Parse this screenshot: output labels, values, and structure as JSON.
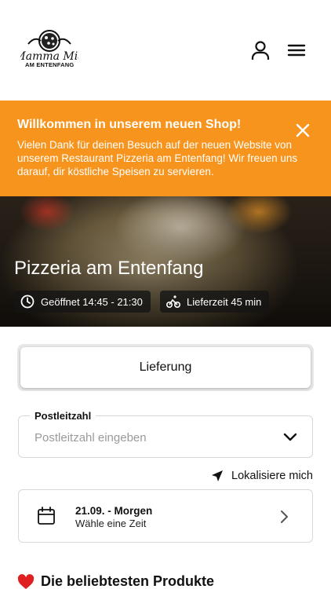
{
  "header": {
    "logo_text": "Mamma Mia",
    "logo_subtitle": "AM ENTENFANG"
  },
  "banner": {
    "title": "Willkommen in unserem neuen Shop!",
    "text": "Vielen Dank für deinen Besuch auf der neuen Website von unserem Restaurant Pizzeria am Entenfang! Wir freuen uns darauf, dir köstliche Speisen zu servieren."
  },
  "hero": {
    "title": "Pizzeria am Entenfang",
    "opening_hours": "Geöffnet 14:45 - 21:30",
    "delivery_time": "Lieferzeit 45 min"
  },
  "order_mode": {
    "selected_label": "Lieferung"
  },
  "postcode": {
    "label": "Postleitzahl",
    "placeholder": "Postleitzahl eingeben",
    "value": ""
  },
  "locate": {
    "label": "Lokalisiere mich"
  },
  "schedule": {
    "date_label": "21.09. - Morgen",
    "time_label": "Wähle eine Zeit"
  },
  "popular": {
    "heading": "Die beliebtesten Produkte"
  },
  "colors": {
    "accent": "#f7941d",
    "text": "#111111",
    "heart": "#e02020"
  },
  "icons": {
    "account": "user-icon",
    "menu": "hamburger-menu-icon",
    "close": "close-icon",
    "clock": "clock-icon",
    "bike": "bicycle-icon",
    "chevron_down": "chevron-down-icon",
    "locate": "location-arrow-icon",
    "calendar": "calendar-icon",
    "chevron_right": "chevron-right-icon",
    "heart": "heart-icon"
  }
}
